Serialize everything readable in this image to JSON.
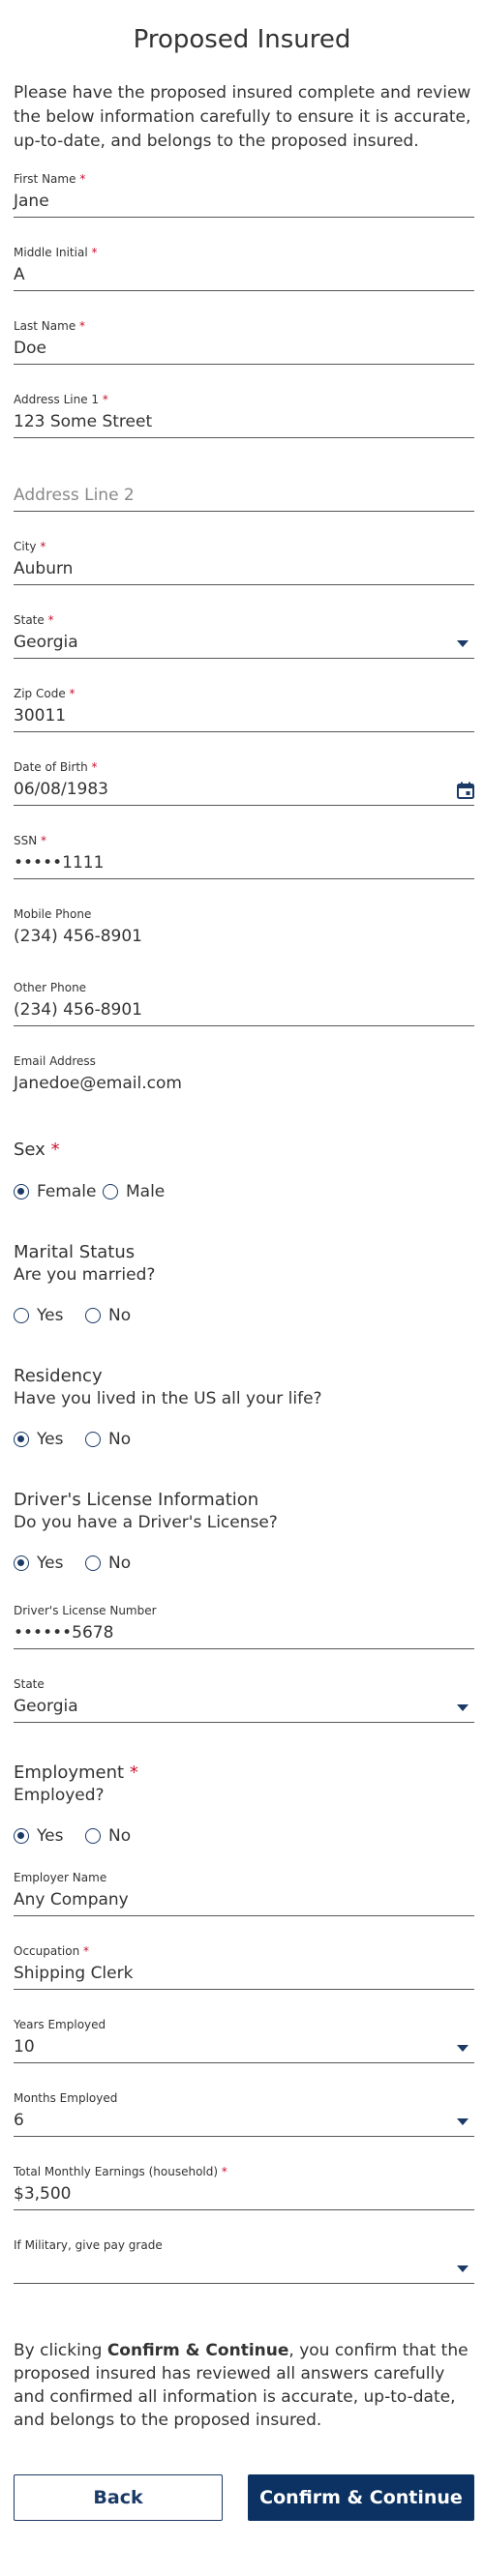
{
  "title": "Proposed Insured",
  "intro": "Please have the proposed insured complete and review the below information carefully to ensure it is accurate, up-to-date, and belongs to the proposed insured.",
  "required_mark": "*",
  "fields": {
    "first_name": {
      "label": "First Name",
      "value": "Jane"
    },
    "middle_initial": {
      "label": "Middle Initial",
      "value": "A"
    },
    "last_name": {
      "label": "Last Name",
      "value": "Doe"
    },
    "address1": {
      "label": "Address Line 1",
      "value": "123 Some Street"
    },
    "address2": {
      "placeholder": "Address Line 2"
    },
    "city": {
      "label": "City",
      "value": "Auburn"
    },
    "state": {
      "label": "State",
      "value": "Georgia"
    },
    "zip": {
      "label": "Zip Code",
      "value": "30011"
    },
    "dob": {
      "label": "Date of Birth",
      "value": "06/08/1983"
    },
    "ssn": {
      "label": "SSN",
      "value": "•••••1111"
    },
    "mobile_phone": {
      "label": "Mobile Phone",
      "value": "(234) 456-8901"
    },
    "other_phone": {
      "label": "Other Phone",
      "value": "(234) 456-8901"
    },
    "email": {
      "label": "Email Address",
      "value": "Janedoe@email.com"
    },
    "dl_number": {
      "label": "Driver's License Number",
      "value": "••••••5678"
    },
    "dl_state": {
      "label": "State",
      "value": "Georgia"
    },
    "employer_name": {
      "label": "Employer Name",
      "value": "Any Company"
    },
    "occupation": {
      "label": "Occupation",
      "value": "Shipping Clerk"
    },
    "years_employed": {
      "label": "Years Employed",
      "value": "10"
    },
    "months_employed": {
      "label": "Months Employed",
      "value": "6"
    },
    "monthly_earnings": {
      "label": "Total Monthly Earnings (household)",
      "value": "$3,500"
    },
    "military_grade": {
      "label": "If Military, give pay grade",
      "value": ""
    }
  },
  "sex": {
    "title": "Sex",
    "options": [
      "Female",
      "Male"
    ],
    "selected": "Female"
  },
  "marital": {
    "title": "Marital Status",
    "question": "Are you married?",
    "options": [
      "Yes",
      "No"
    ],
    "selected": null
  },
  "residency": {
    "title": "Residency",
    "question": "Have you lived in the US all your life?",
    "options": [
      "Yes",
      "No"
    ],
    "selected": "Yes"
  },
  "license": {
    "title": "Driver's License Information",
    "question": "Do you have a Driver's License?",
    "options": [
      "Yes",
      "No"
    ],
    "selected": "Yes"
  },
  "employment": {
    "title": "Employment",
    "question": "Employed?",
    "options": [
      "Yes",
      "No"
    ],
    "selected": "Yes"
  },
  "disclaimer": {
    "prefix": "By clicking ",
    "bold": "Confirm & Continue",
    "suffix": ", you confirm that the proposed insured has reviewed all answers carefully and confirmed all information is accurate, up-to-date, and belongs to the proposed insured."
  },
  "buttons": {
    "back": "Back",
    "confirm": "Confirm & Continue"
  },
  "colors": {
    "primary": "#0b3262",
    "required": "#c8102e"
  }
}
